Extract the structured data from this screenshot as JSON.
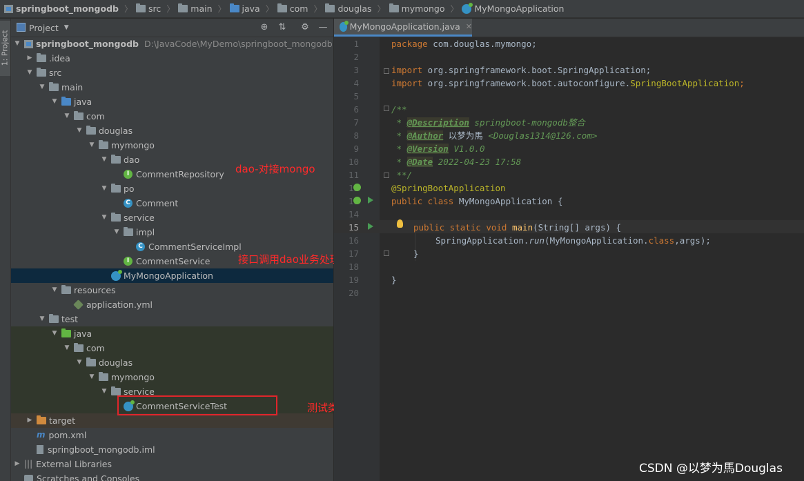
{
  "breadcrumb": [
    "springboot_mongodb",
    "src",
    "main",
    "java",
    "com",
    "douglas",
    "mymongo",
    "MyMongoApplication"
  ],
  "side_strip": {
    "label": "1: Project"
  },
  "project_panel": {
    "title": "Project"
  },
  "tree": [
    {
      "label": "springboot_mongodb",
      "path": "D:\\JavaCode\\MyDemo\\springboot_mongodb"
    },
    {
      "label": ".idea"
    },
    {
      "label": "src"
    },
    {
      "label": "main"
    },
    {
      "label": "java"
    },
    {
      "label": "com"
    },
    {
      "label": "douglas"
    },
    {
      "label": "mymongo"
    },
    {
      "label": "dao"
    },
    {
      "label": "CommentRepository"
    },
    {
      "label": "po"
    },
    {
      "label": "Comment"
    },
    {
      "label": "service"
    },
    {
      "label": "impl"
    },
    {
      "label": "CommentServiceImpl"
    },
    {
      "label": "CommentService"
    },
    {
      "label": "MyMongoApplication"
    },
    {
      "label": "resources"
    },
    {
      "label": "application.yml"
    },
    {
      "label": "test"
    },
    {
      "label": "java"
    },
    {
      "label": "com"
    },
    {
      "label": "douglas"
    },
    {
      "label": "mymongo"
    },
    {
      "label": "service"
    },
    {
      "label": "CommentServiceTest"
    },
    {
      "label": "target"
    },
    {
      "label": "pom.xml"
    },
    {
      "label": "springboot_mongodb.iml"
    },
    {
      "label": "External Libraries"
    },
    {
      "label": "Scratches and Consoles"
    }
  ],
  "annotations": {
    "dao": "dao-对接mongo",
    "service": "接口调用dao业务处理",
    "test": "测试类"
  },
  "editor": {
    "tab": "MyMongoApplication.java",
    "line_numbers": [
      "1",
      "2",
      "3",
      "4",
      "5",
      "6",
      "7",
      "8",
      "9",
      "10",
      "11",
      "12",
      "13",
      "14",
      "15",
      "16",
      "17",
      "18",
      "19",
      "20"
    ],
    "code": {
      "l1_kw": "package",
      "l1_rest": " com.douglas.mymongo;",
      "l3_kw": "import",
      "l3_rest": " org.springframework.boot.SpringApplication;",
      "l4_kw": "import",
      "l4_mid": " org.springframework.boot.autoconfigure.",
      "l4_cls": "SpringBootApplication",
      "l4_end": ";",
      "l6": "/**",
      "l7_star": " * ",
      "l7_tag": "@Description",
      "l7_text": " springboot-mongodb整合",
      "l8_star": " * ",
      "l8_tag": "@Author",
      "l8_name": " 以梦为馬 ",
      "l8_text": "<Douglas1314@126.com>",
      "l9_star": " * ",
      "l9_tag": "@Version",
      "l9_text": " V1.0.0",
      "l10_star": " * ",
      "l10_tag": "@Date",
      "l10_text": " 2022-04-23 17:58",
      "l11": " **/",
      "l12": "@SpringBootApplication",
      "l13_kw": "public class",
      "l13_rest": " MyMongoApplication {",
      "l15_kw": "public static void",
      "l15_fn": " main",
      "l15_rest": "(String[] args) {",
      "l16_a": "SpringApplication.",
      "l16_run": "run",
      "l16_b": "(MyMongoApplication.",
      "l16_cls": "class",
      "l16_c": ",args);",
      "l17": "}",
      "l19": "}"
    }
  },
  "watermark": "CSDN @以梦为馬Douglas"
}
